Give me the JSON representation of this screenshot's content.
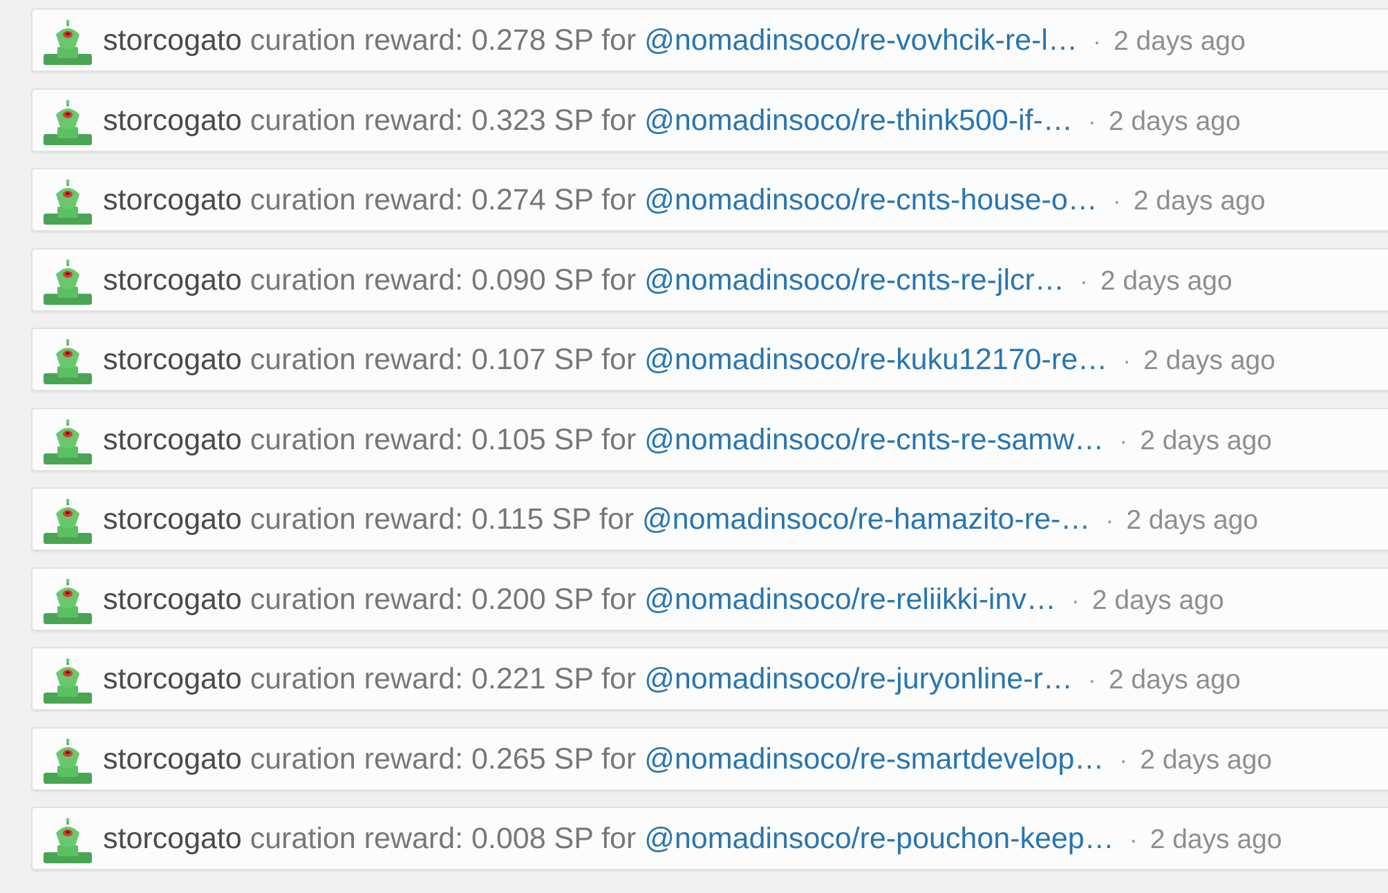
{
  "colors": {
    "background": "#f0f0f0",
    "card": "#fcfcfc",
    "username": "#4a4a4a",
    "reward_text": "#777777",
    "link": "#2775b3",
    "timestamp": "#8e8e8e",
    "avatar_green": "#5cbf62",
    "avatar_red": "#d63b32"
  },
  "avatar_icon": "green-robot-avatar",
  "feed": {
    "items": [
      {
        "user": "storcogato",
        "prefix": "curation reward: 0.278 SP for",
        "link": "@nomadinsoco/re-vovhcik-re-l…",
        "separator": "·",
        "time": "2 days ago"
      },
      {
        "user": "storcogato",
        "prefix": "curation reward: 0.323 SP for",
        "link": "@nomadinsoco/re-think500-if-…",
        "separator": "·",
        "time": "2 days ago"
      },
      {
        "user": "storcogato",
        "prefix": "curation reward: 0.274 SP for",
        "link": "@nomadinsoco/re-cnts-house-o…",
        "separator": "·",
        "time": "2 days ago"
      },
      {
        "user": "storcogato",
        "prefix": "curation reward: 0.090 SP for",
        "link": "@nomadinsoco/re-cnts-re-jlcr…",
        "separator": "·",
        "time": "2 days ago"
      },
      {
        "user": "storcogato",
        "prefix": "curation reward: 0.107 SP for",
        "link": "@nomadinsoco/re-kuku12170-re…",
        "separator": "·",
        "time": "2 days ago"
      },
      {
        "user": "storcogato",
        "prefix": "curation reward: 0.105 SP for",
        "link": "@nomadinsoco/re-cnts-re-samw…",
        "separator": "·",
        "time": "2 days ago"
      },
      {
        "user": "storcogato",
        "prefix": "curation reward: 0.115 SP for",
        "link": "@nomadinsoco/re-hamazito-re-…",
        "separator": "·",
        "time": "2 days ago"
      },
      {
        "user": "storcogato",
        "prefix": "curation reward: 0.200 SP for",
        "link": "@nomadinsoco/re-reliikki-inv…",
        "separator": "·",
        "time": "2 days ago"
      },
      {
        "user": "storcogato",
        "prefix": "curation reward: 0.221 SP for",
        "link": "@nomadinsoco/re-juryonline-r…",
        "separator": "·",
        "time": "2 days ago"
      },
      {
        "user": "storcogato",
        "prefix": "curation reward: 0.265 SP for",
        "link": "@nomadinsoco/re-smartdevelop…",
        "separator": "·",
        "time": "2 days ago"
      },
      {
        "user": "storcogato",
        "prefix": "curation reward: 0.008 SP for",
        "link": "@nomadinsoco/re-pouchon-keep…",
        "separator": "·",
        "time": "2 days ago"
      }
    ]
  }
}
